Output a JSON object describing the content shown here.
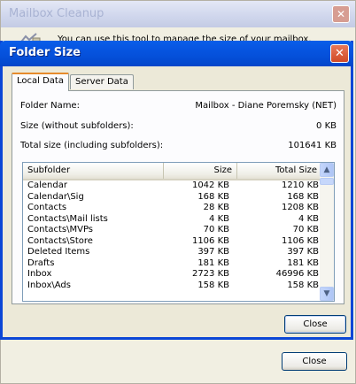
{
  "background_window": {
    "title": "Mailbox Cleanup",
    "description": "You can use this tool to manage the size of your mailbox.",
    "close_label": "Close",
    "close_glyph": "✕"
  },
  "dialog": {
    "title": "Folder Size",
    "close_glyph": "✕",
    "tabs": [
      {
        "label": "Local Data",
        "active": true
      },
      {
        "label": "Server Data",
        "active": false
      }
    ],
    "folder_name_label": "Folder Name:",
    "folder_name_value": "Mailbox - Diane Poremsky (NET)",
    "size_label": "Size (without subfolders):",
    "size_value": "0 KB",
    "total_label": "Total size (including subfolders):",
    "total_value": "101641 KB",
    "table": {
      "columns": [
        "Subfolder",
        "Size",
        "Total Size"
      ],
      "rows": [
        [
          "Calendar",
          "1042 KB",
          "1210 KB"
        ],
        [
          "Calendar\\Sig",
          "168 KB",
          "168 KB"
        ],
        [
          "Contacts",
          "28 KB",
          "1208 KB"
        ],
        [
          "Contacts\\Mail lists",
          "4 KB",
          "4 KB"
        ],
        [
          "Contacts\\MVPs",
          "70 KB",
          "70 KB"
        ],
        [
          "Contacts\\Store",
          "1106 KB",
          "1106 KB"
        ],
        [
          "Deleted Items",
          "397 KB",
          "397 KB"
        ],
        [
          "Drafts",
          "181 KB",
          "181 KB"
        ],
        [
          "Inbox",
          "2723 KB",
          "46996 KB"
        ],
        [
          "Inbox\\Ads",
          "158 KB",
          "158 KB"
        ]
      ]
    },
    "close_label": "Close",
    "scroll_up_glyph": "▲",
    "scroll_down_glyph": "▼"
  },
  "colors": {
    "titlebar_blue": "#0550da",
    "close_red": "#d14a26",
    "dialog_face": "#ece9d8"
  }
}
